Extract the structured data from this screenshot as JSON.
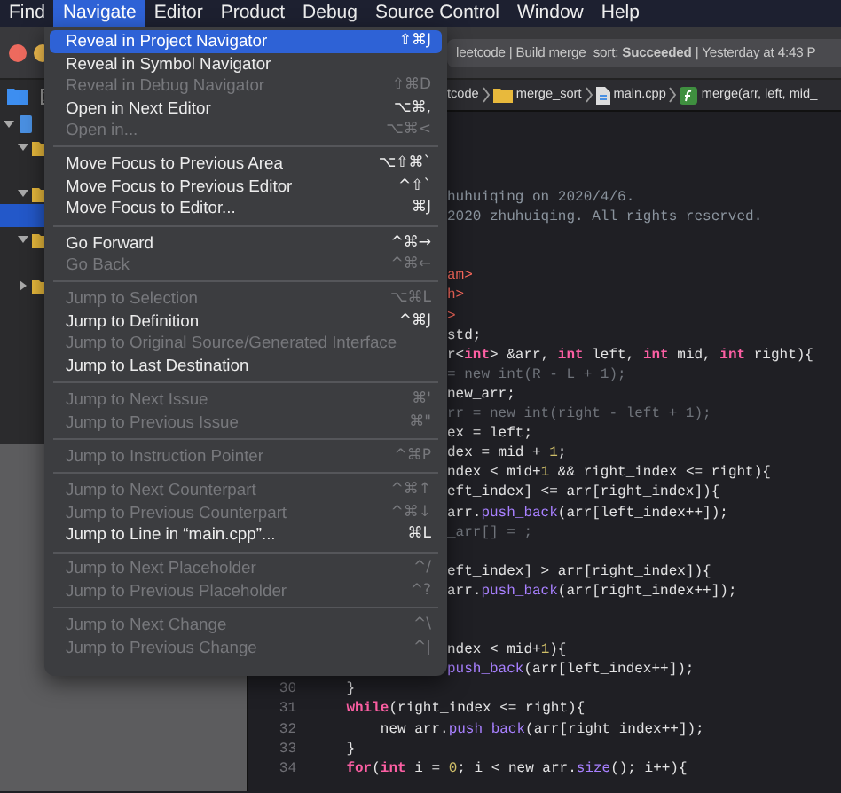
{
  "menu_bar": [
    {
      "label": "Find",
      "selected": false
    },
    {
      "label": "Navigate",
      "selected": true
    },
    {
      "label": "Editor",
      "selected": false
    },
    {
      "label": "Product",
      "selected": false
    },
    {
      "label": "Debug",
      "selected": false
    },
    {
      "label": "Source Control",
      "selected": false
    },
    {
      "label": "Window",
      "selected": false
    },
    {
      "label": "Help",
      "selected": false
    }
  ],
  "toolbar": {
    "status": "leetcode | Build merge_sort: **Succeeded** | Yesterday at 4:43 P"
  },
  "navigator": {
    "tree": [
      {
        "kind": "project",
        "expanded": true,
        "selected": false,
        "children": [
          {
            "kind": "folder",
            "expanded": true,
            "selected": false
          },
          {
            "kind": "folder",
            "expanded": true,
            "selected": false,
            "children": [
              {
                "selected": true
              }
            ]
          },
          {
            "kind": "folder",
            "expanded": true,
            "selected": false
          },
          {
            "kind": "folder",
            "expanded": false,
            "selected": false
          }
        ]
      }
    ]
  },
  "jump_bar": [
    {
      "kind": "project",
      "label": "tcode"
    },
    {
      "kind": "folder",
      "label": "merge_sort"
    },
    {
      "kind": "file",
      "label": "main.cpp"
    },
    {
      "kind": "function",
      "label": "merge(arr, left, mid_"
    }
  ],
  "code": [
    {
      "kind": "clipped",
      "segments": [
        {
          "kind": "comment",
          "text": "huhuiqing on 2020/4/6."
        }
      ]
    },
    {
      "kind": "clipped",
      "segments": [
        {
          "kind": "comment",
          "text": "2020 zhuhuiqing. All rights reserved."
        }
      ]
    },
    {
      "kind": "blank"
    },
    {
      "kind": "blank"
    },
    {
      "kind": "clipped",
      "segments": [
        {
          "kind": "string",
          "text": "am>"
        }
      ]
    },
    {
      "kind": "clipped",
      "segments": [
        {
          "kind": "string",
          "text": "h>"
        }
      ]
    },
    {
      "kind": "clipped",
      "segments": [
        {
          "kind": "string",
          "text": ">"
        }
      ]
    },
    {
      "kind": "clipped",
      "segments": [
        {
          "kind": "plain",
          "text": "std;"
        }
      ]
    },
    {
      "kind": "clipped",
      "segments": [
        {
          "kind": "plain",
          "text": "r<"
        },
        {
          "kind": "keyword",
          "text": "int"
        },
        {
          "kind": "plain",
          "text": "> &arr, "
        },
        {
          "kind": "keyword",
          "text": "int"
        },
        {
          "kind": "plain",
          "text": " left, "
        },
        {
          "kind": "keyword",
          "text": "int"
        },
        {
          "kind": "plain",
          "text": " mid, "
        },
        {
          "kind": "keyword",
          "text": "int"
        },
        {
          "kind": "plain",
          "text": " right){"
        }
      ]
    },
    {
      "kind": "clipped",
      "segments": [
        {
          "kind": "dim",
          "text": "= new int(R - L + 1);"
        }
      ]
    },
    {
      "kind": "clipped",
      "segments": [
        {
          "kind": "plain",
          "text": "new_arr;"
        }
      ]
    },
    {
      "kind": "clipped",
      "segments": [
        {
          "kind": "dim",
          "text": "rr = new int(right - left + 1);"
        }
      ]
    },
    {
      "kind": "clipped",
      "segments": [
        {
          "kind": "plain",
          "text": "ex = left;"
        }
      ]
    },
    {
      "kind": "clipped",
      "segments": [
        {
          "kind": "plain",
          "text": "dex = mid + "
        },
        {
          "kind": "number",
          "text": "1"
        },
        {
          "kind": "plain",
          "text": ";"
        }
      ]
    },
    {
      "kind": "clipped",
      "segments": [
        {
          "kind": "plain",
          "text": "ndex < mid+"
        },
        {
          "kind": "number",
          "text": "1"
        },
        {
          "kind": "plain",
          "text": " && right_index <= right){"
        }
      ]
    },
    {
      "kind": "clipped",
      "segments": [
        {
          "kind": "plain",
          "text": "eft_index] <= arr[right_index]){"
        }
      ]
    },
    {
      "kind": "clipped",
      "segments": [
        {
          "kind": "plain",
          "text": "arr."
        },
        {
          "kind": "method",
          "text": "push_back"
        },
        {
          "kind": "plain",
          "text": "(arr[left_index++]);"
        }
      ]
    },
    {
      "kind": "clipped",
      "segments": [
        {
          "kind": "dim",
          "text": "_arr[] = ;"
        }
      ]
    },
    {
      "kind": "blank"
    },
    {
      "kind": "clipped",
      "segments": [
        {
          "kind": "plain",
          "text": "eft_index] > arr[right_index]){"
        }
      ]
    },
    {
      "kind": "clipped",
      "segments": [
        {
          "kind": "plain",
          "text": "arr."
        },
        {
          "kind": "method",
          "text": "push_back"
        },
        {
          "kind": "plain",
          "text": "(arr[right_index++]);"
        }
      ]
    },
    {
      "kind": "blank"
    },
    {
      "kind": "blank"
    },
    {
      "kind": "clipped",
      "segments": [
        {
          "kind": "plain",
          "text": "ndex < mid+"
        },
        {
          "kind": "number",
          "text": "1"
        },
        {
          "kind": "plain",
          "text": "){"
        }
      ]
    },
    {
      "kind": "clipped",
      "segments": [
        {
          "kind": "method",
          "text": "push_back"
        },
        {
          "kind": "plain",
          "text": "(arr[left_index++]);"
        }
      ]
    },
    {
      "kind": "full",
      "number": "30",
      "segments": [
        {
          "kind": "plain",
          "text": "    }"
        }
      ]
    },
    {
      "kind": "full",
      "number": "31",
      "segments": [
        {
          "kind": "keyword",
          "text": "    while"
        },
        {
          "kind": "plain",
          "text": "(right_index <= right){"
        }
      ]
    },
    {
      "kind": "full",
      "number": "32",
      "segments": [
        {
          "kind": "plain",
          "text": "        new_arr."
        },
        {
          "kind": "method",
          "text": "push_back"
        },
        {
          "kind": "plain",
          "text": "(arr[right_index++]);"
        }
      ]
    },
    {
      "kind": "full",
      "number": "33",
      "segments": [
        {
          "kind": "plain",
          "text": "    }"
        }
      ]
    },
    {
      "kind": "full",
      "number": "34",
      "segments": [
        {
          "kind": "keyword",
          "text": "    for"
        },
        {
          "kind": "plain",
          "text": "("
        },
        {
          "kind": "keyword",
          "text": "int"
        },
        {
          "kind": "plain",
          "text": " i = "
        },
        {
          "kind": "number",
          "text": "0"
        },
        {
          "kind": "plain",
          "text": "; i < new_arr."
        },
        {
          "kind": "method",
          "text": "size"
        },
        {
          "kind": "plain",
          "text": "(); i++){"
        }
      ]
    }
  ],
  "navigate_menu": {
    "groups": [
      [
        {
          "label": "Reveal in Project Navigator",
          "shortcut": "⇧⌘J",
          "disabled": false,
          "selected": true
        },
        {
          "label": "Reveal in Symbol Navigator",
          "disabled": false,
          "selected": false
        },
        {
          "label": "Reveal in Debug Navigator",
          "shortcut": "⇧⌘D",
          "disabled": true,
          "selected": false
        },
        {
          "label": "Open in Next Editor",
          "shortcut": "⌥⌘,",
          "disabled": false,
          "selected": false
        },
        {
          "label": "Open in...",
          "shortcut": "⌥⌘<",
          "disabled": true,
          "selected": false
        }
      ],
      [
        {
          "label": "Move Focus to Previous Area",
          "shortcut": "⌥⇧⌘`",
          "disabled": false,
          "selected": false
        },
        {
          "label": "Move Focus to Previous Editor",
          "shortcut": "^⇧`",
          "disabled": false,
          "selected": false
        },
        {
          "label": "Move Focus to Editor...",
          "shortcut": "⌘J",
          "disabled": false,
          "selected": false
        }
      ],
      [
        {
          "label": "Go Forward",
          "shortcut": "^⌘→",
          "disabled": false,
          "selected": false
        },
        {
          "label": "Go Back",
          "shortcut": "^⌘←",
          "disabled": true,
          "selected": false
        }
      ],
      [
        {
          "label": "Jump to Selection",
          "shortcut": "⌥⌘L",
          "disabled": true,
          "selected": false
        },
        {
          "label": "Jump to Definition",
          "shortcut": "^⌘J",
          "disabled": false,
          "selected": false
        },
        {
          "label": "Jump to Original Source/Generated Interface",
          "disabled": true,
          "selected": false
        },
        {
          "label": "Jump to Last Destination",
          "disabled": false,
          "selected": false
        }
      ],
      [
        {
          "label": "Jump to Next Issue",
          "shortcut": "⌘'",
          "disabled": true,
          "selected": false
        },
        {
          "label": "Jump to Previous Issue",
          "shortcut": "⌘\"",
          "disabled": true,
          "selected": false
        }
      ],
      [
        {
          "label": "Jump to Instruction Pointer",
          "shortcut": "^⌘P",
          "disabled": true,
          "selected": false
        }
      ],
      [
        {
          "label": "Jump to Next Counterpart",
          "shortcut": "^⌘↑",
          "disabled": true,
          "selected": false
        },
        {
          "label": "Jump to Previous Counterpart",
          "shortcut": "^⌘↓",
          "disabled": true,
          "selected": false
        },
        {
          "label": "Jump to Line in “main.cpp”...",
          "shortcut": "⌘L",
          "disabled": false,
          "selected": false
        }
      ],
      [
        {
          "label": "Jump to Next Placeholder",
          "shortcut": "^/",
          "disabled": true,
          "selected": false
        },
        {
          "label": "Jump to Previous Placeholder",
          "shortcut": "^?",
          "disabled": true,
          "selected": false
        }
      ],
      [
        {
          "label": "Jump to Next Change",
          "shortcut": "^\\",
          "disabled": true,
          "selected": false
        },
        {
          "label": "Jump to Previous Change",
          "shortcut": "^|",
          "disabled": true,
          "selected": false
        }
      ]
    ]
  }
}
